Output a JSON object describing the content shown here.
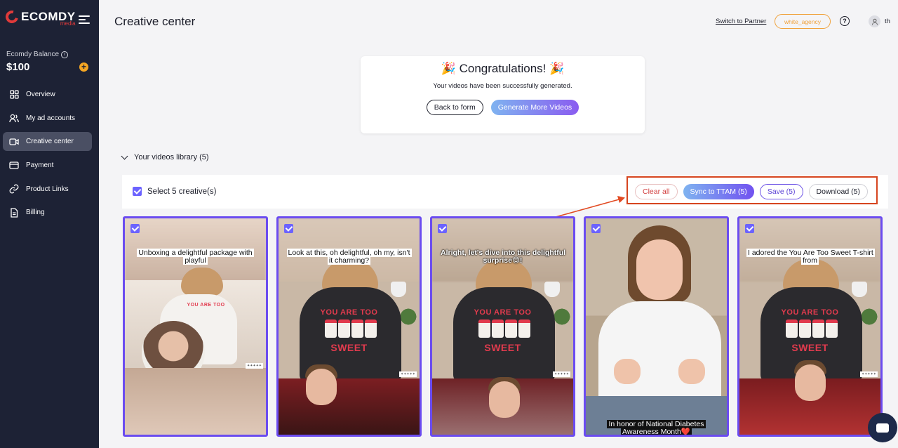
{
  "sidebar": {
    "logo_text": "ECOMDY",
    "logo_sub": "media",
    "balance_label": "Ecomdy Balance",
    "balance_value": "$100",
    "items": [
      {
        "label": "Overview",
        "icon": "grid-icon"
      },
      {
        "label": "My ad accounts",
        "icon": "users-icon"
      },
      {
        "label": "Creative center",
        "icon": "video-icon",
        "active": true
      },
      {
        "label": "Payment",
        "icon": "card-icon"
      },
      {
        "label": "Product Links",
        "icon": "link-icon"
      },
      {
        "label": "Billing",
        "icon": "document-icon"
      }
    ]
  },
  "header": {
    "title": "Creative center",
    "switch_label": "Switch to Partner",
    "agency_badge": "white_agency",
    "user_name": "th"
  },
  "congrats": {
    "title": "🎉 Congratulations! 🎉",
    "subtitle": "Your videos have been successfully generated.",
    "back_label": "Back to form",
    "generate_label": "Generate More Videos"
  },
  "library": {
    "title": "Your videos library (5)",
    "select_label": "Select 5 creative(s)",
    "actions": {
      "clear": "Clear all",
      "sync": "Sync to TTAM (5)",
      "save": "Save (5)",
      "download": "Download (5)"
    },
    "videos": [
      {
        "caption": "Unboxing a delightful package with playful"
      },
      {
        "caption": "Look at this, oh delightful, oh my, isn't it charming?"
      },
      {
        "caption": "Alright, let's dive into this delightful surprise😊!"
      },
      {
        "caption": "In honor of National Diabetes Awareness Month❤️"
      },
      {
        "caption": "I adored the You Are Too Sweet T-shirt from"
      }
    ],
    "shirt_text_1": "YOU ARE TOO",
    "shirt_text_2": "SWEET"
  },
  "colors": {
    "sidebar_bg": "#1d2235",
    "accent": "#6b4cf0",
    "highlight": "#d6451f",
    "badge": "#f0a23b"
  }
}
